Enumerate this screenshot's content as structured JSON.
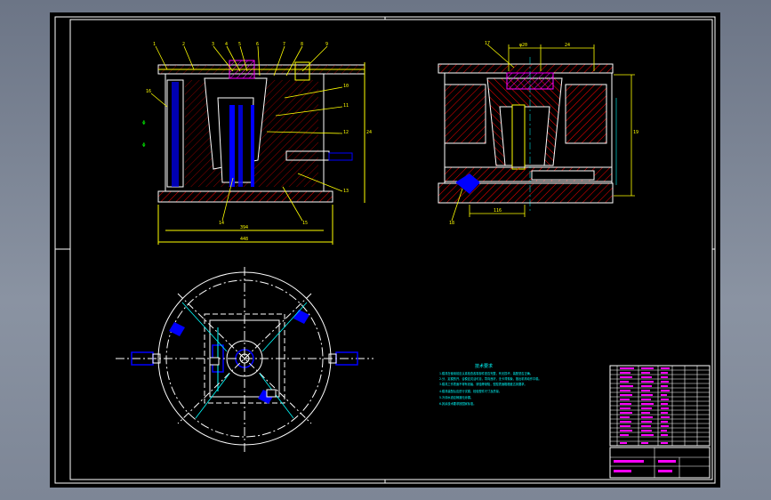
{
  "drawing": {
    "kind": "CAD mold assembly drawing",
    "view_labels": {
      "front_width_inner": "394",
      "front_width_outer": "448",
      "front_height": "24",
      "side_top_left": "φ20",
      "side_top_right": "24",
      "side_bottom": "116"
    },
    "part_numbers": [
      "1",
      "2",
      "3",
      "4",
      "5",
      "6",
      "7",
      "8",
      "9",
      "10",
      "11",
      "12",
      "13",
      "14",
      "15",
      "16",
      "17",
      "18",
      "19",
      "20"
    ],
    "notes": {
      "title": "技术要求",
      "lines": [
        "1.模具在使用前应认真检查各零部件是否完整，有无损坏，装配是否正确。",
        "2.分、定模的开、合模应灵活可靠，导向良好，无卡滞现象，推出机构动作平稳。",
        "3.模具工作表面不得有划痕、锈蚀等缺陷，型腔表面粗糙度达到要求。",
        "4.模具装配后应进行试模，检验塑件尺寸及质量。",
        "5.冷却水道应畅通无渗漏。",
        "6.其余技术要求按国家标准。"
      ]
    },
    "title_block": {
      "rows": [
        "",
        "",
        "",
        "",
        "",
        "",
        "",
        "",
        "",
        "",
        "",
        "",
        "",
        "",
        "",
        "",
        ""
      ],
      "name_cell": "",
      "scale_cell": ""
    },
    "colors": {
      "sheet": "#000000",
      "frame": "#ffffff",
      "outline": "#ffffff",
      "yellow": "#ffff00",
      "green": "#00ff00",
      "cyan": "#00ffff",
      "blue": "#0000ff",
      "red": "#ff0000",
      "magenta": "#ff00ff",
      "hatch": "#ff0000"
    }
  }
}
